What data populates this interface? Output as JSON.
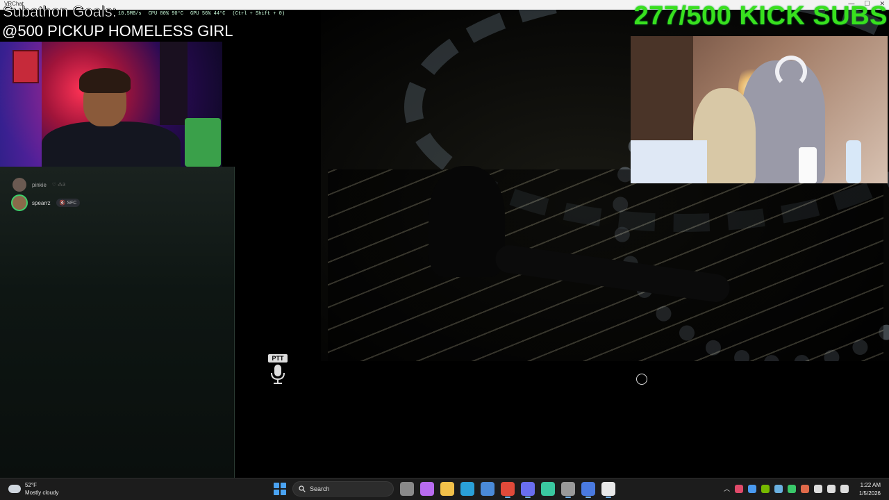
{
  "titlebar": {
    "app_name": "VRChat",
    "controls": [
      "—",
      "☐",
      "✕"
    ]
  },
  "overlay": {
    "perf": {
      "network": "10.5MB/s",
      "cpu": "CPU  80%  90°C",
      "gpu": "GPU  56%  44°C",
      "hotkey": "(Ctrl + Shift + 0)"
    },
    "goal_title": "Subathon Goals:",
    "goal_line": "@500 PICKUP HOMELESS GIRL",
    "kick_subs": "277/500 KICK SUBS",
    "ptt_label": "PTT"
  },
  "voice_users": [
    {
      "name": "pinkie",
      "status": "♡  ⁂3",
      "active": false
    },
    {
      "name": "spearrz",
      "tag": "🔇 SFC",
      "active": true
    }
  ],
  "taskbar": {
    "weather": {
      "temp": "52°F",
      "condition": "Mostly cloudy"
    },
    "search_label": "Search",
    "apps": [
      {
        "name": "task-view",
        "color": "#8a8a8a"
      },
      {
        "name": "copilot",
        "color": "#b86cf0"
      },
      {
        "name": "file-explorer",
        "color": "#f2c14a"
      },
      {
        "name": "edge",
        "color": "#2aa0d8"
      },
      {
        "name": "store",
        "color": "#4a8ad8"
      },
      {
        "name": "chrome",
        "color": "#e04a3a"
      },
      {
        "name": "discord",
        "color": "#6a6ef0"
      },
      {
        "name": "spotify",
        "color": "#3ac8a0"
      },
      {
        "name": "obs",
        "color": "#9a9a9a"
      },
      {
        "name": "notes",
        "color": "#4a7ae0"
      },
      {
        "name": "vrchat",
        "color": "#e8e8e8"
      }
    ],
    "tray": {
      "caret": "︿",
      "icons": [
        {
          "name": "discord-tray",
          "color": "#e04a6a"
        },
        {
          "name": "bluetooth",
          "color": "#4a9af0"
        },
        {
          "name": "nvidia",
          "color": "#76b900"
        },
        {
          "name": "steam",
          "color": "#6ab0e0"
        },
        {
          "name": "security",
          "color": "#3ac86a"
        },
        {
          "name": "mic",
          "color": "#e06a4a"
        },
        {
          "name": "network",
          "color": "#dddddd"
        },
        {
          "name": "volume",
          "color": "#dddddd"
        },
        {
          "name": "battery",
          "color": "#dddddd"
        }
      ]
    },
    "time": "1:22 AM",
    "date": "1/5/2026"
  }
}
